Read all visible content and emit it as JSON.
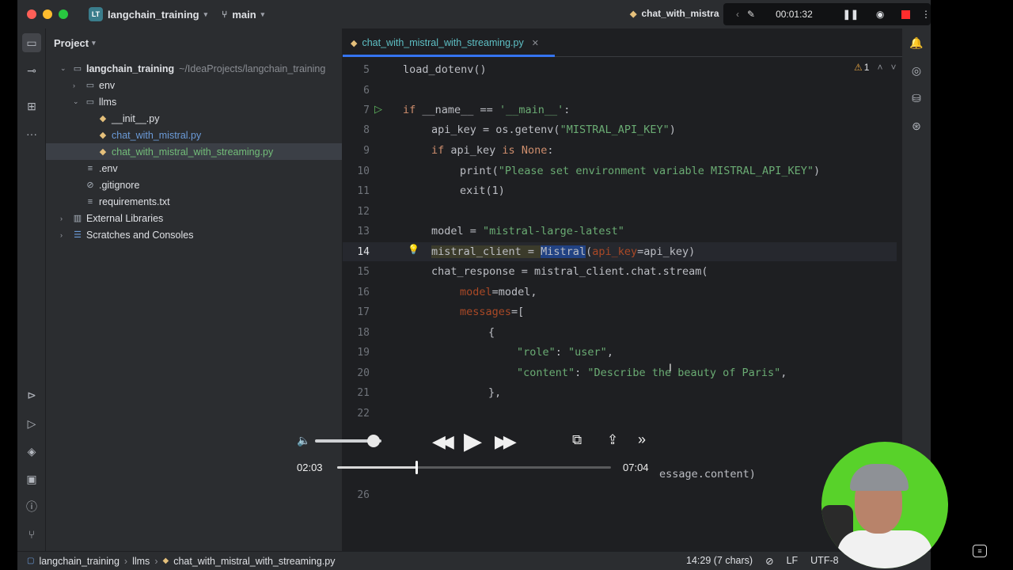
{
  "titlebar": {
    "project_badge": "LT",
    "project_name": "langchain_training",
    "branch": "main",
    "run_config": "chat_with_mistra",
    "recording_time": "00:01:32"
  },
  "project_panel": {
    "title": "Project",
    "tree": [
      {
        "label": "langchain_training",
        "hint": "~/IdeaProjects/langchain_training",
        "indent": 0,
        "expanded": "true",
        "type": "folder"
      },
      {
        "label": "env",
        "indent": 1,
        "expanded": "false",
        "type": "folder"
      },
      {
        "label": "llms",
        "indent": 1,
        "expanded": "true",
        "type": "folder"
      },
      {
        "label": "__init__.py",
        "indent": 2,
        "type": "py"
      },
      {
        "label": "chat_with_mistral.py",
        "indent": 2,
        "type": "py-changed"
      },
      {
        "label": "chat_with_mistral_with_streaming.py",
        "indent": 2,
        "type": "py-new"
      },
      {
        "label": ".env",
        "indent": 1,
        "type": "file"
      },
      {
        "label": ".gitignore",
        "indent": 1,
        "type": "ignore"
      },
      {
        "label": "requirements.txt",
        "indent": 1,
        "type": "txt"
      },
      {
        "label": "External Libraries",
        "indent": 0,
        "expanded": "false",
        "type": "lib"
      },
      {
        "label": "Scratches and Consoles",
        "indent": 0,
        "expanded": "false",
        "type": "scratch"
      }
    ]
  },
  "editor": {
    "tab_label": "chat_with_mistral_with_streaming.py",
    "warning_count": "1",
    "line_numbers": [
      "5",
      "6",
      "7",
      "8",
      "9",
      "10",
      "11",
      "12",
      "13",
      "14",
      "15",
      "16",
      "17",
      "18",
      "19",
      "20",
      "21",
      "22",
      "26"
    ],
    "lines": {
      "l5": "load_dotenv()",
      "l7_kw": "if",
      "l7_rest": " __name__ == ",
      "l7_str": "'__main__'",
      "l7_end": ":",
      "l8_a": "api_key = os.getenv(",
      "l8_str": "\"MISTRAL_API_KEY\"",
      "l8_b": ")",
      "l9_kw": "if",
      "l9_a": " api_key ",
      "l9_kw2": "is",
      "l9_kw3": "None",
      "l9_b": ":",
      "l10_a": "print(",
      "l10_str": "\"Please set environment variable MISTRAL_API_KEY\"",
      "l10_b": ")",
      "l11": "exit(1)",
      "l13_a": "model = ",
      "l13_str": "\"mistral-large-latest\"",
      "l14_a": "mistral_client = ",
      "l14_sel": "Mistral",
      "l14_p": "api_key",
      "l14_b": "=api_key)",
      "l15": "chat_response = mistral_client.chat.stream(",
      "l16_p": "model",
      "l16_b": "=model,",
      "l17_p": "messages",
      "l17_b": "=[",
      "l18": "{",
      "l19_k": "\"role\"",
      "l19_m": ": ",
      "l19_v": "\"user\"",
      "l19_e": ",",
      "l20_k": "\"content\"",
      "l20_m": ": ",
      "l20_v": "\"Describe the beauty of Paris\"",
      "l20_e": ",",
      "l21": "},",
      "l25_tail": "essage.content)"
    }
  },
  "video_player": {
    "elapsed": "02:03",
    "duration": "07:04",
    "progress": 0.29,
    "volume": 0.88
  },
  "statusbar": {
    "crumb_project": "langchain_training",
    "crumb_folder": "llms",
    "crumb_file": "chat_with_mistral_with_streaming.py",
    "position": "14:29 (7 chars)",
    "line_ending": "LF",
    "encoding": "UTF-8"
  }
}
